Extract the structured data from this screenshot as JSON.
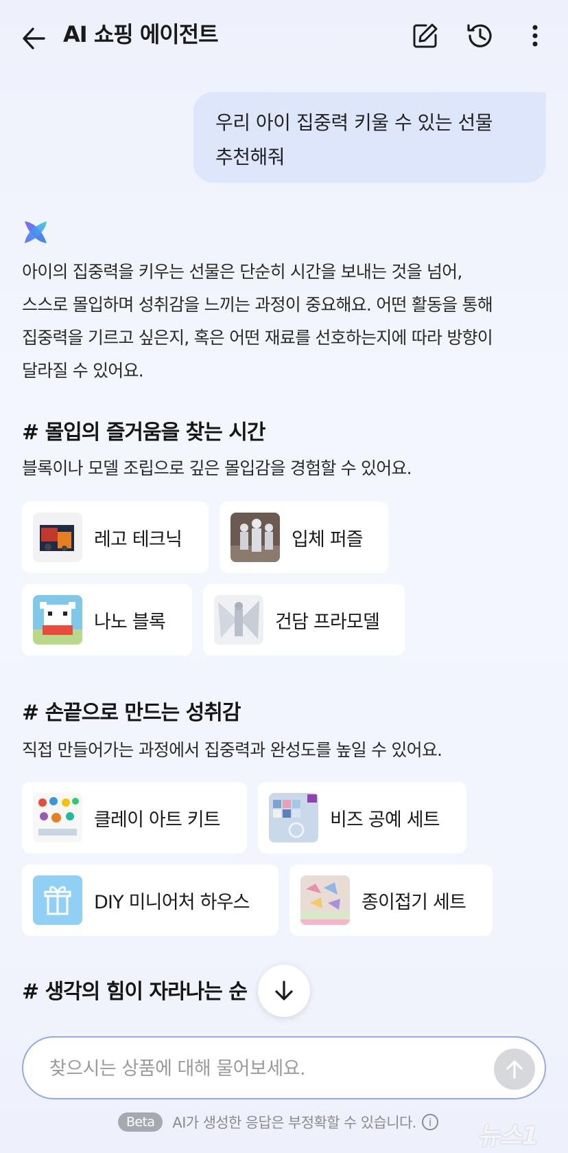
{
  "header": {
    "title": "AI 쇼핑 에이전트",
    "back_icon": "arrow-left-icon",
    "compose_icon": "edit-icon",
    "history_icon": "history-icon",
    "more_icon": "more-vertical-icon"
  },
  "user_message": {
    "line1": "우리 아이 집중력 키울 수 있는 선물",
    "line2": "추천해줘"
  },
  "ai_response": {
    "logo_icon": "ai-logo-icon",
    "intro_lines": [
      "아이의 집중력을 키우는 선물은 단순히 시간을 보내는 것을 넘어,",
      "스스로 몰입하며 성취감을 느끼는 과정이 중요해요. 어떤 활동을 통해",
      "집중력을 기르고 싶은지, 혹은 어떤 재료를 선호하는지에 따라 방향이",
      "달라질 수 있어요."
    ],
    "sections": [
      {
        "heading": "# 몰입의 즐거움을 찾는 시간",
        "description": "블록이나 모델 조립으로 깊은 몰입감을 경험할 수 있어요.",
        "chips": [
          {
            "label": "레고 테크닉"
          },
          {
            "label": "입체 퍼즐"
          },
          {
            "label": "나노 블록"
          },
          {
            "label": "건담 프라모델"
          }
        ]
      },
      {
        "heading": "# 손끝으로 만드는 성취감",
        "description": "직접 만들어가는 과정에서 집중력과 완성도를 높일 수 있어요.",
        "chips": [
          {
            "label": "클레이 아트 키트"
          },
          {
            "label": "비즈 공예 세트"
          },
          {
            "label": "DIY 미니어처 하우스"
          },
          {
            "label": "종이접기 세트"
          }
        ]
      },
      {
        "heading": "# 생각의 힘이 자라나는 순"
      }
    ]
  },
  "scroll_down_icon": "arrow-down-icon",
  "composer": {
    "placeholder": "찾으시는 상품에 대해 물어보세요.",
    "send_icon": "arrow-up-icon"
  },
  "disclaimer": {
    "badge": "Beta",
    "text": "AI가 생성한 응답은 부정확할 수 있습니다.",
    "info_icon": "info-icon"
  },
  "watermark": "뉴스1"
}
